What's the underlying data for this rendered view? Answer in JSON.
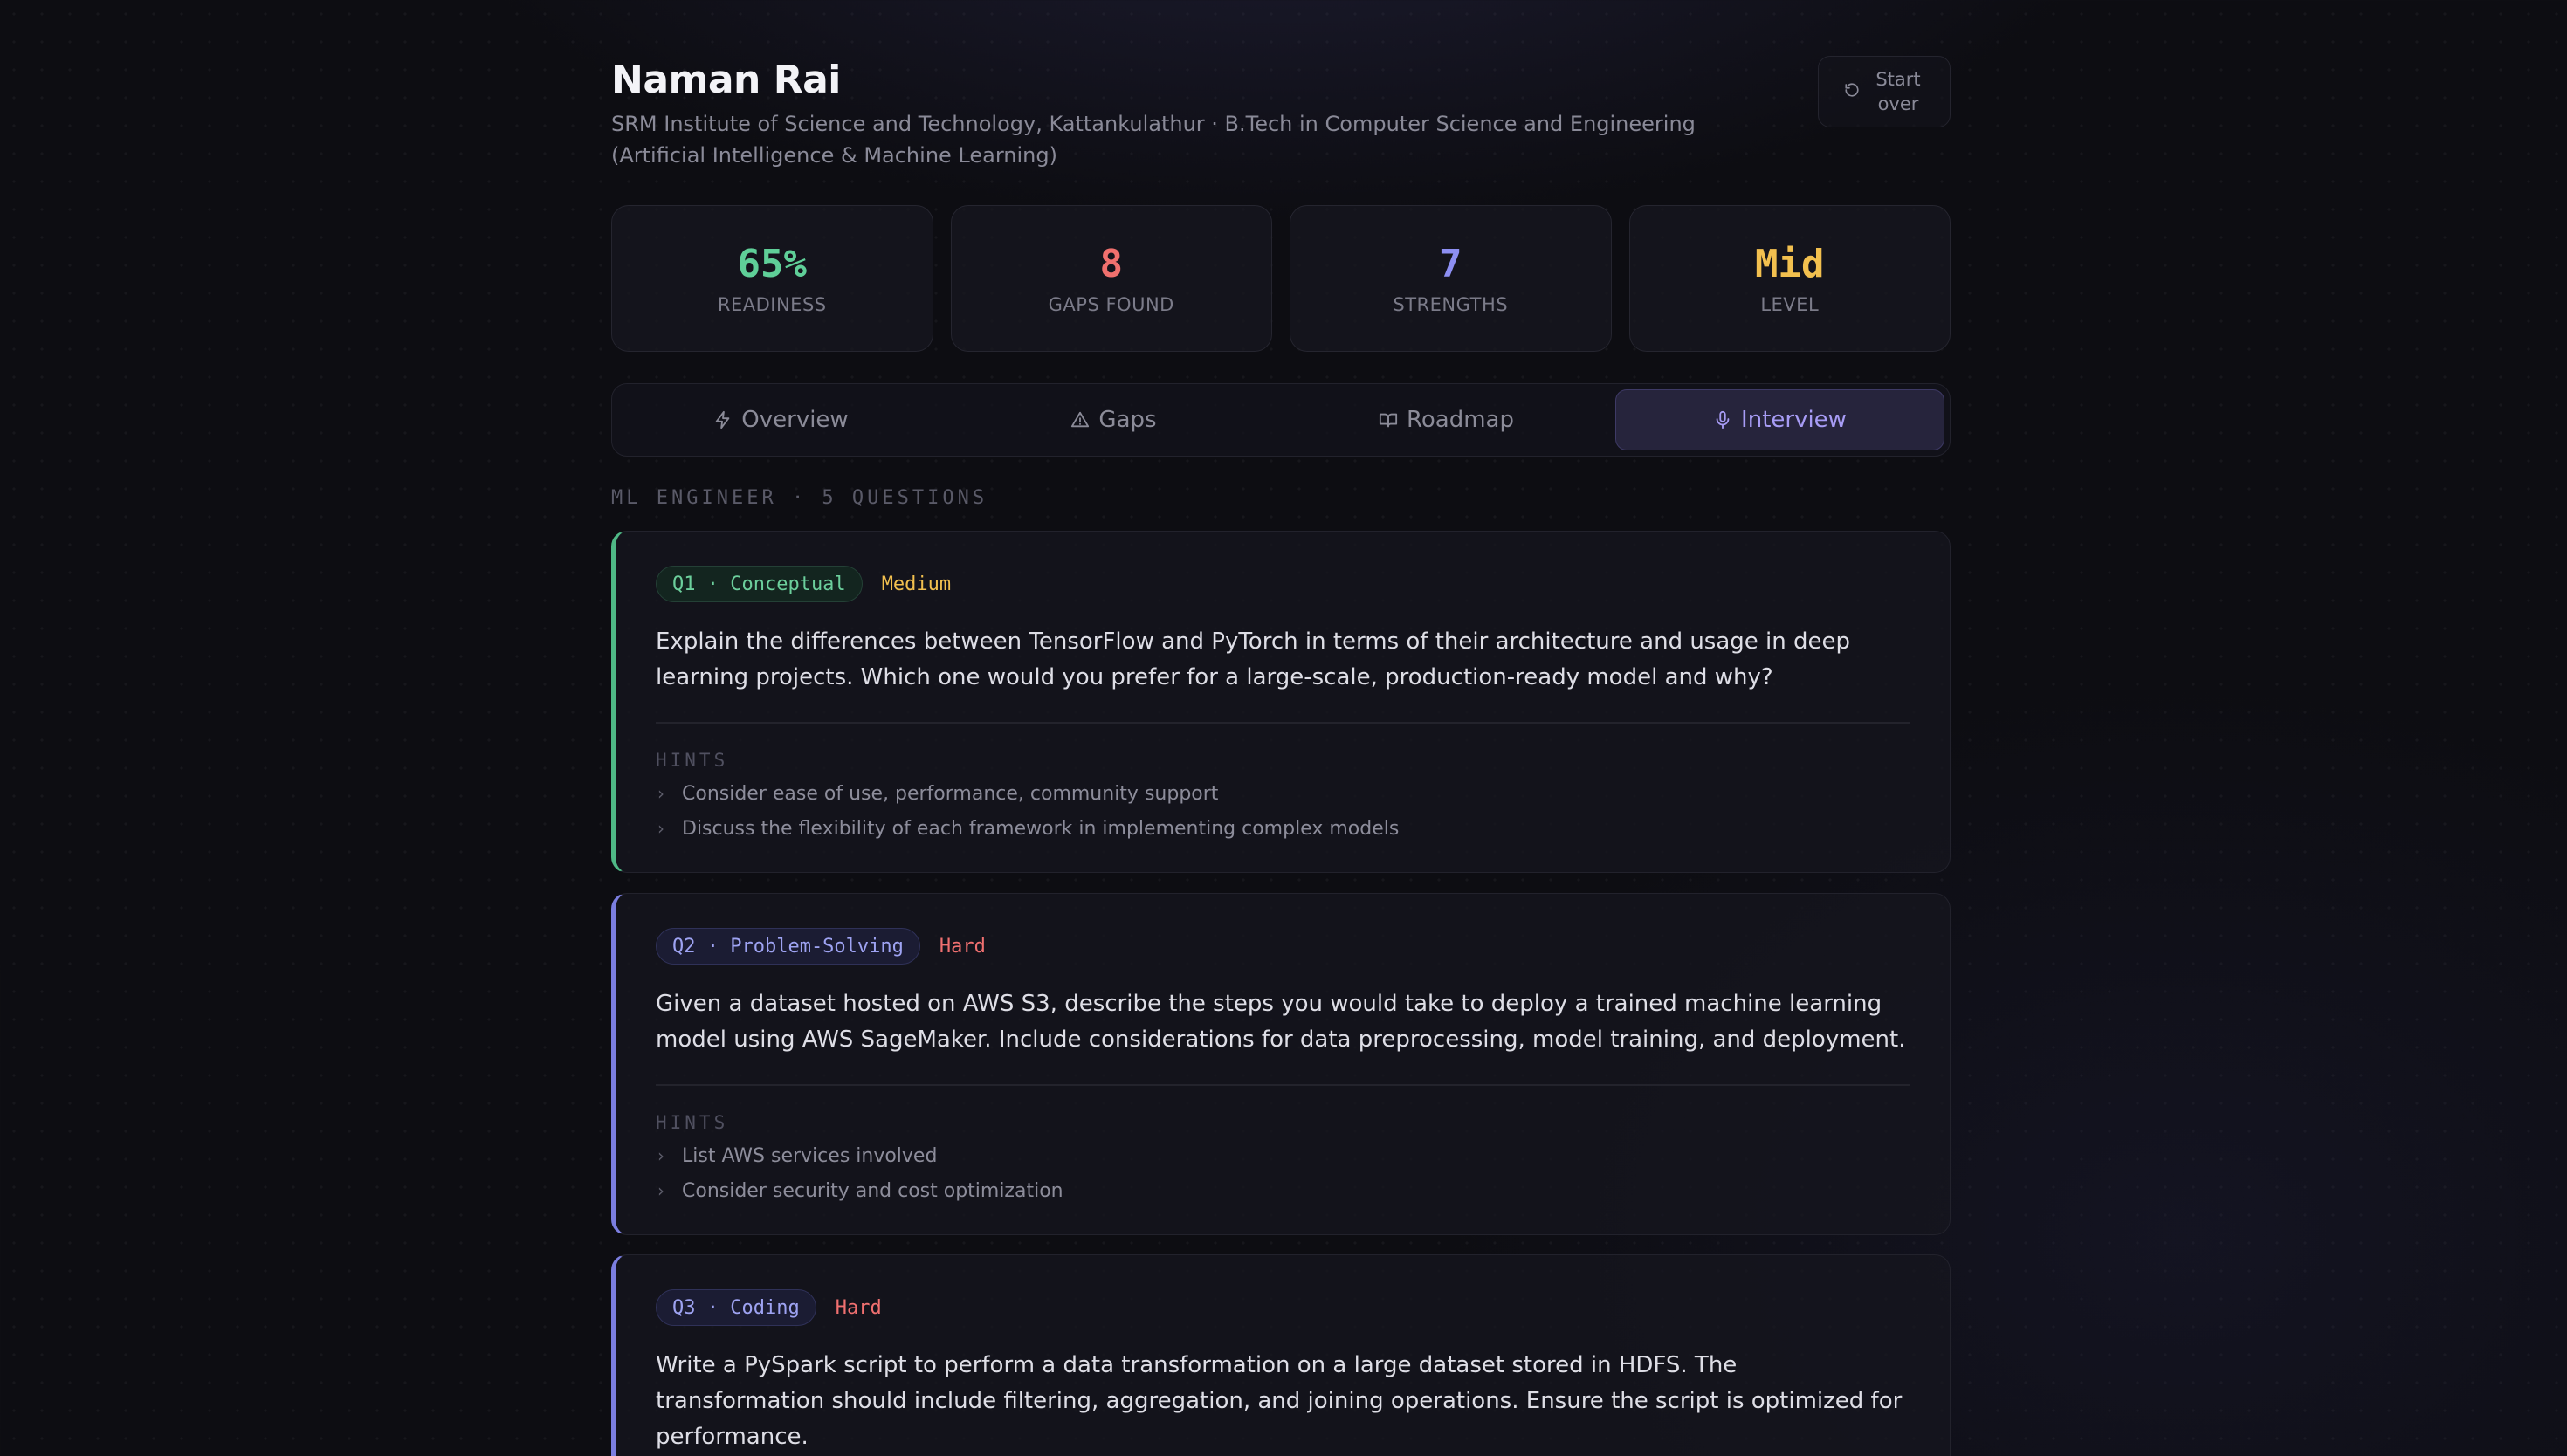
{
  "profile": {
    "name": "Naman Rai",
    "subtitle": "SRM Institute of Science and Technology, Kattankulathur · B.Tech in Computer Science and Engineering (Artificial Intelligence & Machine Learning)"
  },
  "actions": {
    "start_over": "Start over",
    "start_over_icon": "rotate-ccw-icon"
  },
  "stats": [
    {
      "value": "65%",
      "label": "READINESS",
      "color": "#5fcf98"
    },
    {
      "value": "8",
      "label": "GAPS FOUND",
      "color": "#f0706e"
    },
    {
      "value": "7",
      "label": "STRENGTHS",
      "color": "#8d8ff2"
    },
    {
      "value": "Mid",
      "label": "LEVEL",
      "color": "#f2c04f"
    }
  ],
  "tabs": [
    {
      "label": "Overview",
      "icon": "lightning-icon",
      "active": false
    },
    {
      "label": "Gaps",
      "icon": "warning-triangle-icon",
      "active": false
    },
    {
      "label": "Roadmap",
      "icon": "book-open-icon",
      "active": false
    },
    {
      "label": "Interview",
      "icon": "microphone-icon",
      "active": true
    }
  ],
  "section_label": "ML ENGINEER · 5 QUESTIONS",
  "questions": [
    {
      "tag": "Q1 · Conceptual",
      "difficulty": "Medium",
      "text": "Explain the differences between TensorFlow and PyTorch in terms of their architecture and usage in deep learning projects. Which one would you prefer for a large-scale, production-ready model and why?",
      "hints_label": "HINTS",
      "hints": [
        "Consider ease of use, performance, community support",
        "Discuss the flexibility of each framework in implementing complex models"
      ]
    },
    {
      "tag": "Q2 · Problem-Solving",
      "difficulty": "Hard",
      "text": "Given a dataset hosted on AWS S3, describe the steps you would take to deploy a trained machine learning model using AWS SageMaker. Include considerations for data preprocessing, model training, and deployment.",
      "hints_label": "HINTS",
      "hints": [
        "List AWS services involved",
        "Consider security and cost optimization"
      ]
    },
    {
      "tag": "Q3 · Coding",
      "difficulty": "Hard",
      "text": "Write a PySpark script to perform a data transformation on a large dataset stored in HDFS. The transformation should include filtering, aggregation, and joining operations. Ensure the script is optimized for performance."
    }
  ]
}
